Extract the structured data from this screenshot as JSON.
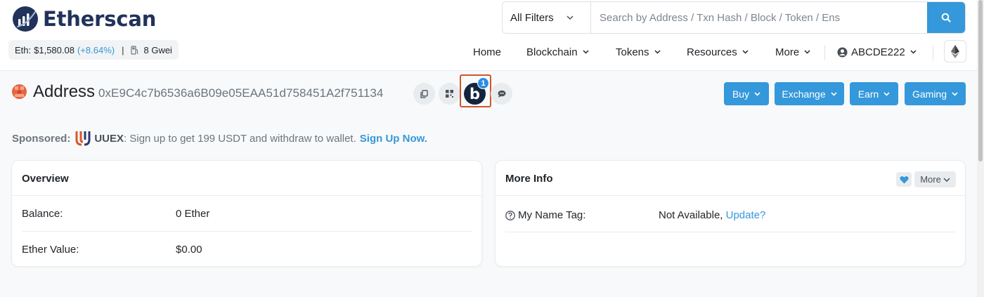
{
  "brand": {
    "name": "Etherscan"
  },
  "ticker": {
    "eth_label": "Eth:",
    "eth_price": "$1,580.08",
    "eth_change": "(+8.64%)",
    "separator": "|",
    "gas": "8 Gwei"
  },
  "search": {
    "filter_label": "All Filters",
    "placeholder": "Search by Address / Txn Hash / Block / Token / Ens"
  },
  "nav": {
    "home": "Home",
    "blockchain": "Blockchain",
    "tokens": "Tokens",
    "resources": "Resources",
    "more": "More",
    "user": "ABCDE222"
  },
  "address": {
    "title": "Address",
    "hash": "0xE9C4c7b6536a6B09e05EAA51d758451A2f751134",
    "b_letter": "b",
    "badge_count": "1"
  },
  "actions": {
    "buy": "Buy",
    "exchange": "Exchange",
    "earn": "Earn",
    "gaming": "Gaming"
  },
  "sponsored": {
    "label": "Sponsored:",
    "brand": "UUEX",
    "message": ": Sign up to get 199 USDT and withdraw to wallet.",
    "cta": "Sign Up Now."
  },
  "overview": {
    "title": "Overview",
    "balance_label": "Balance:",
    "balance_value": "0 Ether",
    "ether_value_label": "Ether Value:",
    "ether_value": "$0.00"
  },
  "more_info": {
    "title": "More Info",
    "more_button": "More",
    "name_tag_label": "My Name Tag:",
    "name_tag_value": "Not Available,",
    "update_link": "Update?"
  },
  "colors": {
    "accent": "#3498db",
    "navy": "#21325b",
    "highlight": "#d2542b",
    "avatar": "#e8643f"
  }
}
